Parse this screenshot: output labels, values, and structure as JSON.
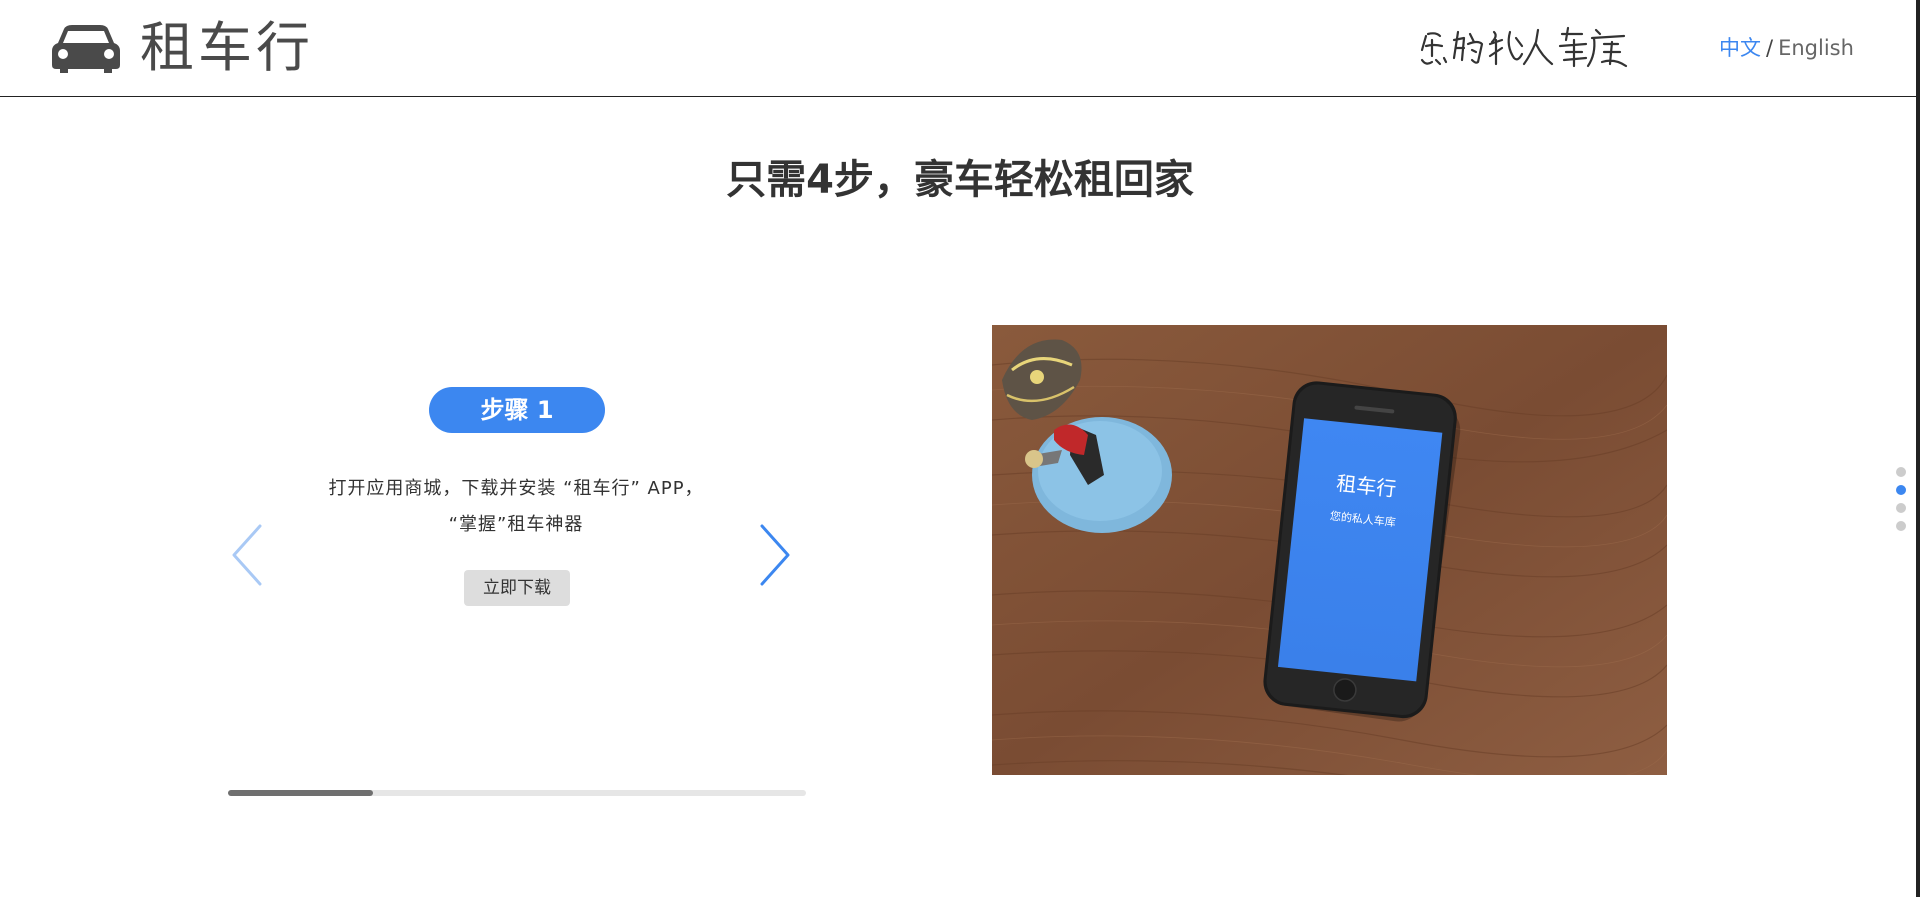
{
  "header": {
    "logo_text": "租车行",
    "slogan_text": "您的私人车库",
    "lang_zh": "中文",
    "lang_sep": "/",
    "lang_en": "English"
  },
  "main": {
    "title": "只需4步，豪车轻松租回家"
  },
  "slider": {
    "step_label": "步骤 1",
    "description_line1": "打开应用商城，下载并安装 “租车行” APP，",
    "description_line2": "“掌握”租车神器",
    "download_label": "立即下载",
    "progress": 0.25
  },
  "photo": {
    "phone_title": "租车行",
    "phone_subtitle": "您的私人车库"
  },
  "page_dots": {
    "count": 4,
    "active_index": 1
  },
  "colors": {
    "accent": "#3c87f0",
    "text_dark": "#333333",
    "badge_text": "#ffffff",
    "button_bg": "#dddddd",
    "progress_fill": "#6f6f6f",
    "progress_track": "#e6e6e6"
  },
  "icons": {
    "logo": "car-icon",
    "prev": "chevron-left-icon",
    "next": "chevron-right-icon"
  }
}
